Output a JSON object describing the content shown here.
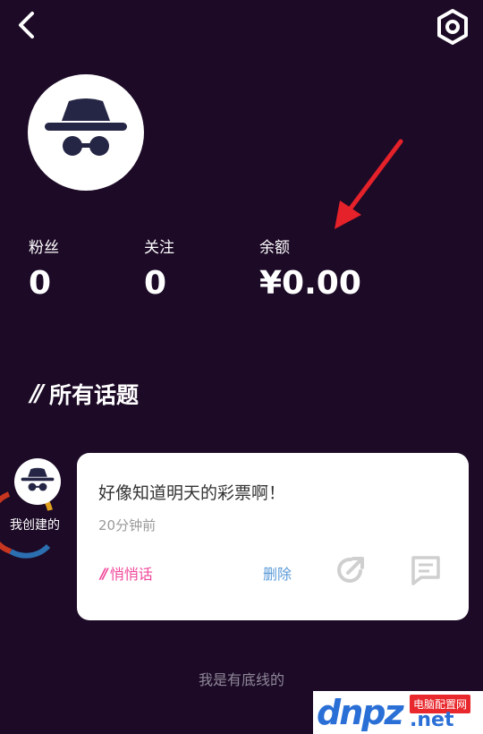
{
  "header": {
    "back_icon": "chevron-left-icon",
    "settings_icon": "settings-hexagon-icon"
  },
  "profile": {
    "avatar_icon": "incognito-hat-glasses-icon"
  },
  "stats": [
    {
      "label": "粉丝",
      "value": "0"
    },
    {
      "label": "关注",
      "value": "0"
    },
    {
      "label": "余额",
      "value": "¥0.00"
    }
  ],
  "annotation": {
    "icon": "red-arrow-icon",
    "color": "#e5212a"
  },
  "topics_section": {
    "slashes": "//",
    "title": "所有话题"
  },
  "topic_card": {
    "creator_label": "我创建的",
    "title": "好像知道明天的彩票啊！",
    "time": "20分钟前",
    "whisper_marks": "//",
    "whisper_label": "悄悄话",
    "delete_label": "删除",
    "share_icon": "share-icon",
    "comment_icon": "comment-icon"
  },
  "footer": {
    "text": "我是有底线的"
  },
  "watermark": {
    "logo": "dnpz",
    "tag": "电脑配置网",
    "domain": ".net"
  },
  "colors": {
    "background": "#1c0a26",
    "accent_pink": "#f0479a",
    "link_blue": "#5a9ad8"
  }
}
